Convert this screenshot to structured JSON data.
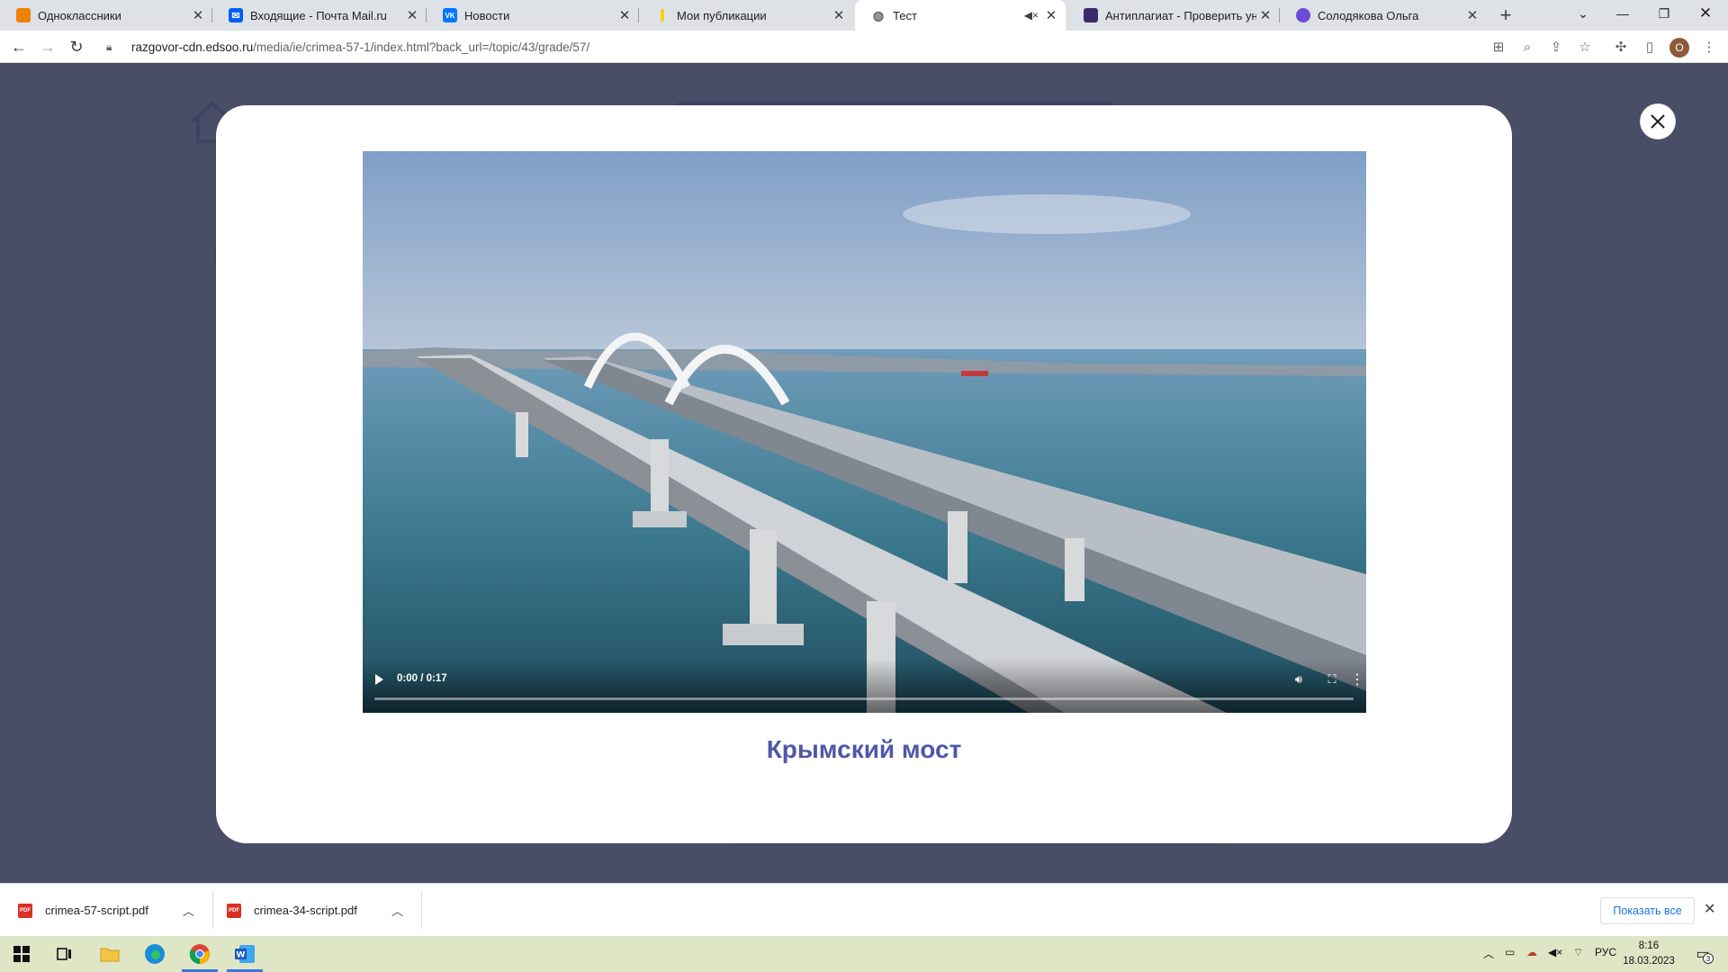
{
  "tabs": [
    {
      "label": "Одноклассники",
      "icon": "odnoklassniki-icon",
      "color": "#ee8208",
      "glyph": "ok"
    },
    {
      "label": "Входящие - Почта Mail.ru",
      "icon": "mail-icon",
      "color": "#005ff9",
      "glyph": "@"
    },
    {
      "label": "Новости",
      "icon": "vk-icon",
      "color": "#0077ff",
      "glyph": "vk"
    },
    {
      "label": "Мои публикации",
      "icon": "zen-icon",
      "color": "#f6d20a",
      "glyph": ""
    },
    {
      "label": "Тест",
      "icon": "globe-icon",
      "color": "#5f6368",
      "glyph": "",
      "active": true,
      "muted": true
    },
    {
      "label": "Антиплагиат - Проверить уник",
      "icon": "antiplagiat-icon",
      "color": "#3c2a6e",
      "glyph": ""
    },
    {
      "label": "Солодякова Ольга",
      "icon": "profile-site-icon",
      "color": "#6a4cd6",
      "glyph": ""
    }
  ],
  "address": {
    "host": "razgovor-cdn.edsoo.ru",
    "path": "/media/ie/crimea-57-1/index.html?back_url=/topic/43/grade/57/"
  },
  "profile": {
    "initial": "О"
  },
  "video": {
    "time": "0:00 / 0:17",
    "progress": 0.0
  },
  "modal": {
    "caption": "Крымский мост"
  },
  "downloads": {
    "items": [
      {
        "name": "crimea-57-script.pdf"
      },
      {
        "name": "crimea-34-script.pdf"
      }
    ],
    "show_all": "Показать все"
  },
  "taskbar": {
    "lang": "РУС",
    "time": "8:16",
    "date": "18.03.2023",
    "notifications": "3"
  },
  "colors": {
    "accent": "#5057a8",
    "overlay": "#4a4d66",
    "taskbar": "#dfe6c6"
  }
}
